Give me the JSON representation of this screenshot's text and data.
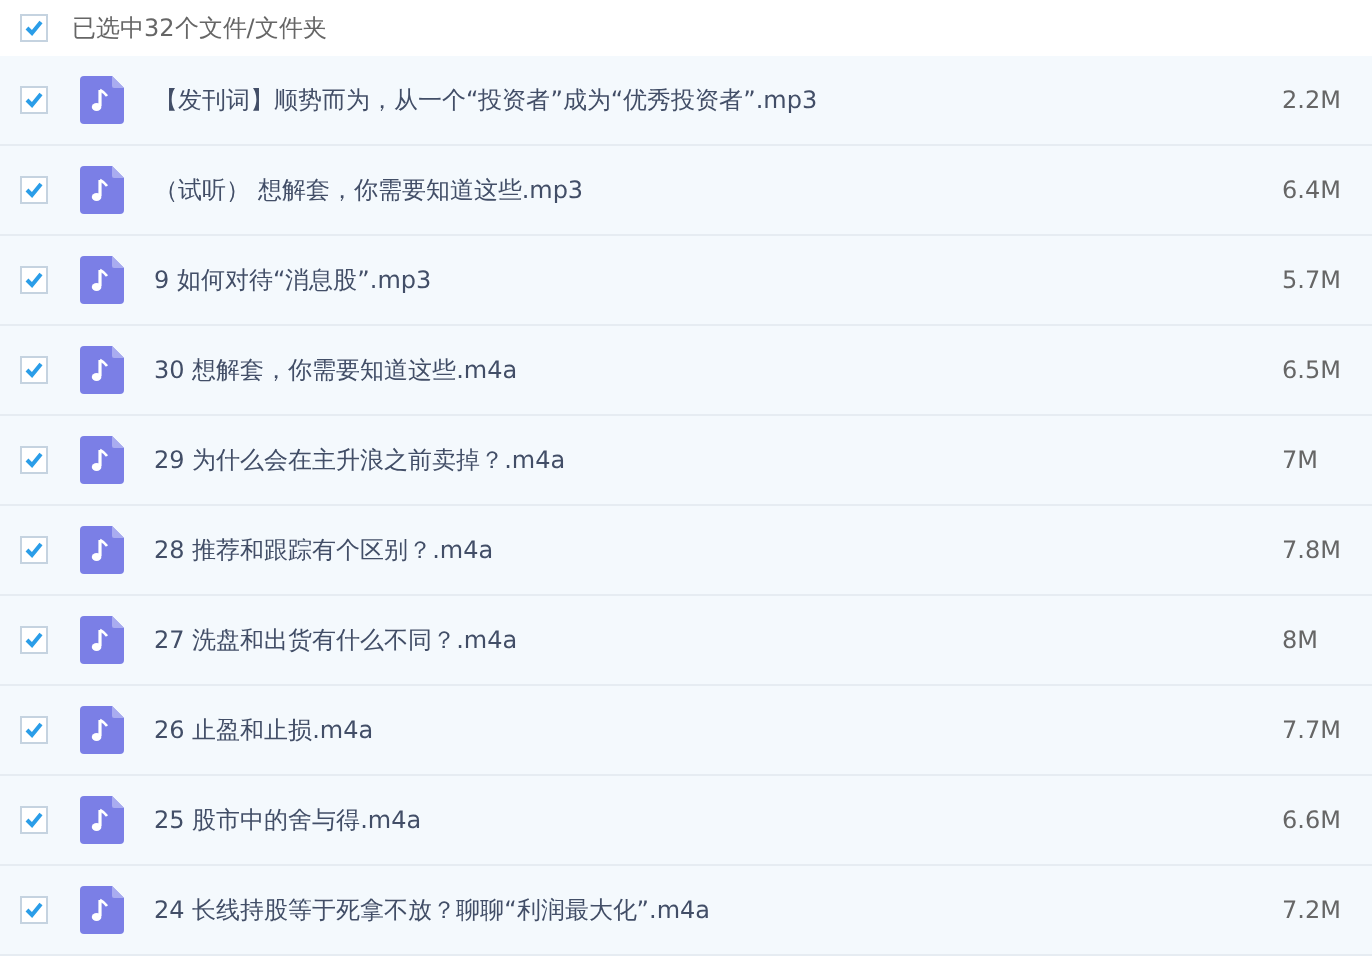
{
  "header": {
    "checked": true,
    "label": "已选中32个文件/文件夹"
  },
  "files": [
    {
      "name": "【发刊词】顺势而为，从一个“投资者”成为“优秀投资者”.mp3",
      "size": "2.2M",
      "checked": true
    },
    {
      "name": "（试听） 想解套，你需要知道这些.mp3",
      "size": "6.4M",
      "checked": true
    },
    {
      "name": "9 如何对待“消息股”.mp3",
      "size": "5.7M",
      "checked": true
    },
    {
      "name": "30 想解套，你需要知道这些.m4a",
      "size": "6.5M",
      "checked": true
    },
    {
      "name": "29 为什么会在主升浪之前卖掉？.m4a",
      "size": "7M",
      "checked": true
    },
    {
      "name": "28 推荐和跟踪有个区别？.m4a",
      "size": "7.8M",
      "checked": true
    },
    {
      "name": "27 洗盘和出货有什么不同？.m4a",
      "size": "8M",
      "checked": true
    },
    {
      "name": "26 止盈和止损.m4a",
      "size": "7.7M",
      "checked": true
    },
    {
      "name": "25 股市中的舍与得.m4a",
      "size": "6.6M",
      "checked": true
    },
    {
      "name": "24 长线持股等于死拿不放？聊聊“利润最大化”.m4a",
      "size": "7.2M",
      "checked": true
    }
  ]
}
